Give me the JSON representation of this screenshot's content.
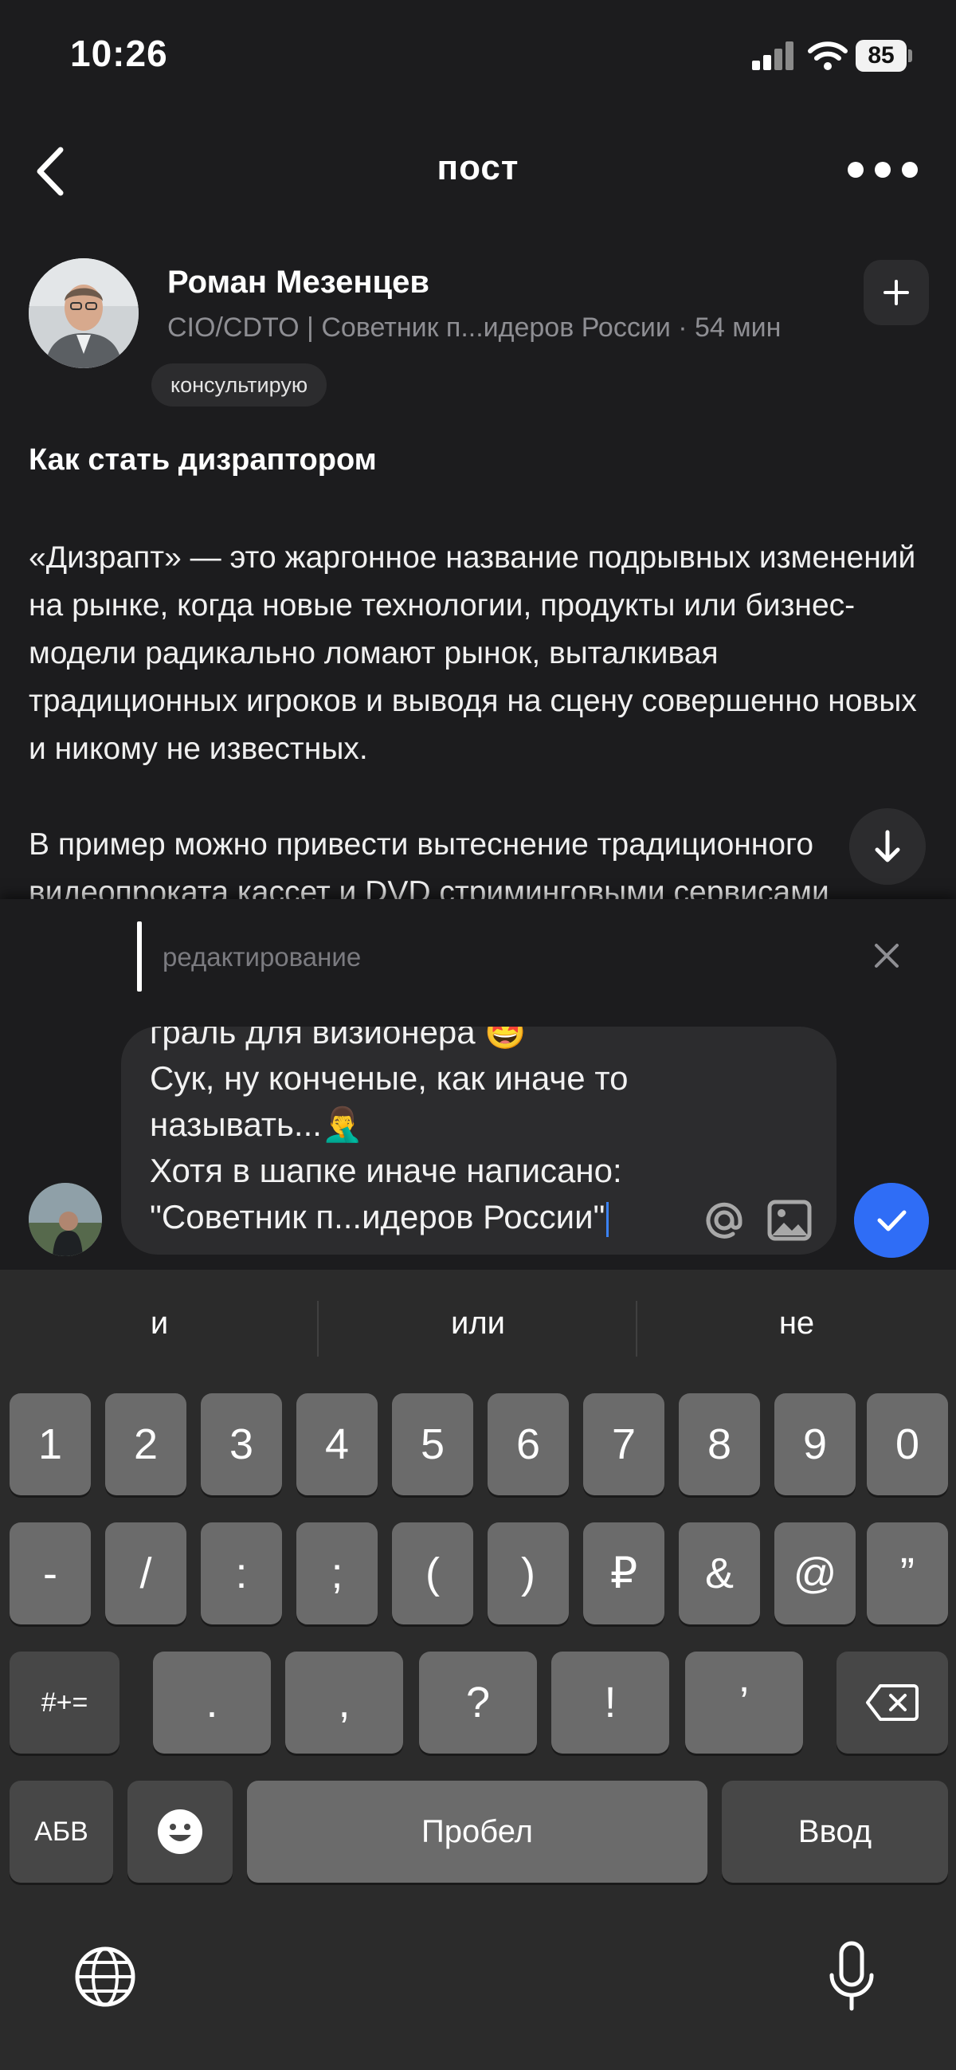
{
  "status_bar": {
    "time": "10:26",
    "battery": "85"
  },
  "nav": {
    "title": "пост"
  },
  "author": {
    "name": "Роман Мезенцев",
    "subtitle": "CIO/CDTO | Советник п...идеров России · 54 мин",
    "tag": "консультирую"
  },
  "post": {
    "title": "Как стать дизраптором",
    "paragraph_1": "«Дизрапт» — это жаргонное название подрывных изменений на рынке, когда новые технологии, продукты или бизнес-модели радикально ломают рынок, выталкивая традиционных игроков и выводя на сцену совершенно новых и никому не известных.",
    "paragraph_2": "В пример можно привести вытеснение традиционного видеопроката кассет и DVD стриминговыми сервисами"
  },
  "editing": {
    "label": "редактирование"
  },
  "composer": {
    "lines": [
      "граль для визионера 🤩",
      "Сук, ну конченые, как иначе то",
      "называть...🤦‍♂️",
      "Хотя в шапке иначе написано:",
      "\"Советник  п...идеров России\""
    ]
  },
  "keyboard": {
    "suggestions": [
      "и",
      "или",
      "не"
    ],
    "row1": [
      "1",
      "2",
      "3",
      "4",
      "5",
      "6",
      "7",
      "8",
      "9",
      "0"
    ],
    "row2": [
      "-",
      "/",
      ":",
      ";",
      "(",
      ")",
      "₽",
      "&",
      "@",
      "”"
    ],
    "row3": [
      ".",
      ",",
      "?",
      "!",
      "’"
    ],
    "symbols_key": "#+=",
    "abc_key": "АБВ",
    "space_key": "Пробел",
    "return_key": "Ввод"
  }
}
